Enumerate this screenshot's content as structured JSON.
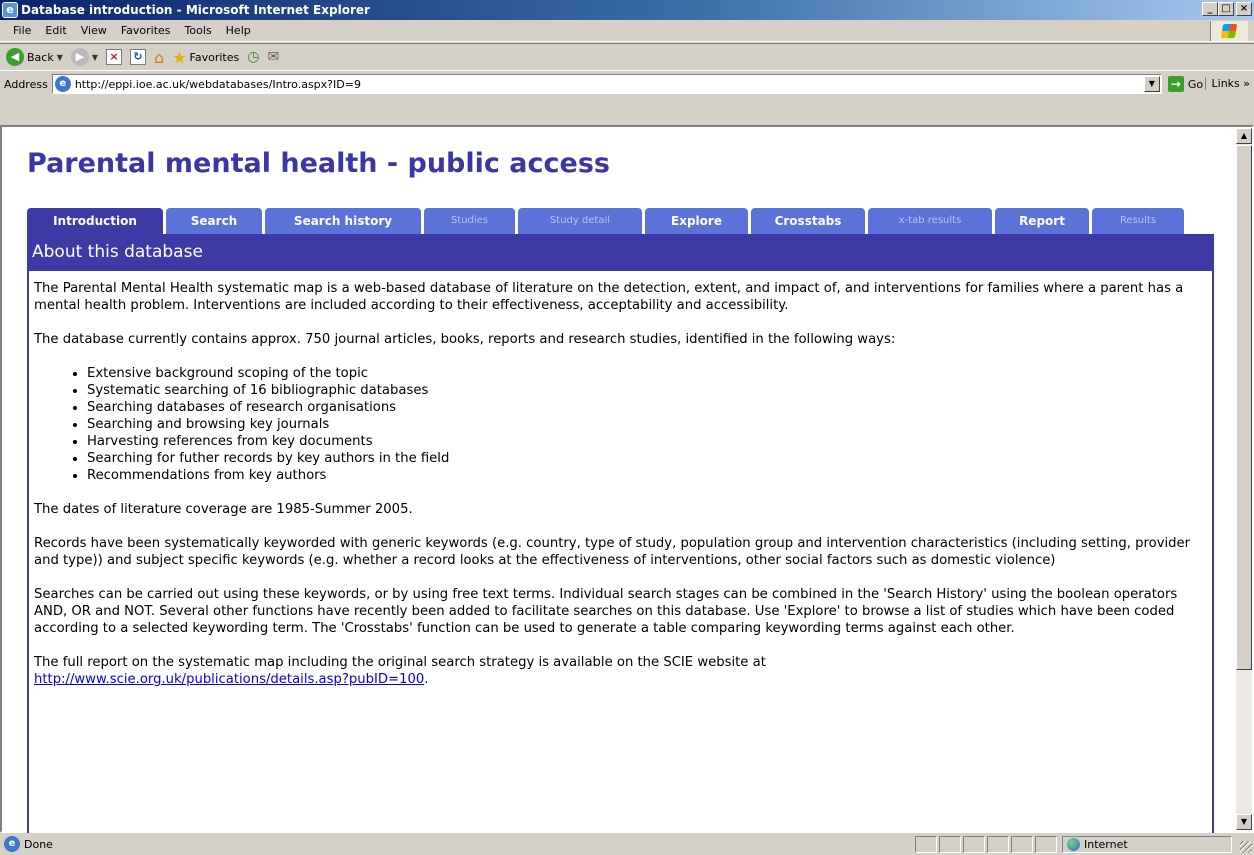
{
  "window": {
    "title": "Database introduction - Microsoft Internet Explorer",
    "minimize": "_",
    "maximize": "□",
    "close": "×"
  },
  "menubar": {
    "items": [
      "File",
      "Edit",
      "View",
      "Favorites",
      "Tools",
      "Help"
    ]
  },
  "toolbar": {
    "back_label": "Back",
    "favorites_label": "Favorites"
  },
  "address": {
    "label": "Address",
    "url": "http://eppi.ioe.ac.uk/webdatabases/Intro.aspx?ID=9",
    "go_label": "Go",
    "links_label": "Links »"
  },
  "page": {
    "title": "Parental mental health - public access",
    "tabs": [
      {
        "label": "Introduction",
        "state": "active"
      },
      {
        "label": "Search",
        "state": "enabled"
      },
      {
        "label": "Search history",
        "state": "enabled"
      },
      {
        "label": "Studies",
        "state": "disabled"
      },
      {
        "label": "Study detail",
        "state": "disabled"
      },
      {
        "label": "Explore",
        "state": "enabled"
      },
      {
        "label": "Crosstabs",
        "state": "enabled"
      },
      {
        "label": "x-tab results",
        "state": "disabled"
      },
      {
        "label": "Report",
        "state": "enabled"
      },
      {
        "label": "Results",
        "state": "disabled"
      }
    ],
    "section_header": "About this database",
    "paragraphs": {
      "intro": "The Parental Mental Health systematic map is a web-based database of literature on the detection, extent, and impact of, and interventions for families where a parent has a mental health problem. Interventions are included according to their effectiveness, acceptability and accessibility.",
      "contents": "The database currently contains approx. 750 journal articles, books, reports and research studies, identified in the following ways:",
      "dates": "The dates of literature coverage are 1985-Summer 2005.",
      "keywords": "Records have been systematically keyworded with generic keywords (e.g. country, type of study, population group and intervention characteristics (including setting, provider and type)) and subject specific keywords (e.g. whether a record looks at the effectiveness of interventions, other social factors such as domestic violence)",
      "searches": "Searches can be carried out using these keywords, or by using free text terms. Individual search stages can be combined in the 'Search History' using the boolean operators AND, OR and NOT. Several other functions have recently been added to facilitate searches on this database. Use 'Explore' to browse a list of studies which have been coded according to a selected keywording term. The 'Crosstabs' function can be used to generate a table comparing keywording terms against each other.",
      "report": "The full report on the systematic map including the original search strategy is available on the SCIE website at",
      "report_link": "http://www.scie.org.uk/publications/details.asp?pubID=100",
      "report_end": "."
    },
    "methods": [
      "Extensive background scoping of the topic",
      "Systematic searching of 16 bibliographic databases",
      "Searching databases of research organisations",
      "Searching and browsing key journals",
      "Harvesting references from key documents",
      "Searching for futher records by key authors in the field",
      "Recommendations from key authors"
    ]
  },
  "statusbar": {
    "text": "Done",
    "zone": "Internet"
  },
  "colors": {
    "title_text": "#3a37a5",
    "tab_active": "#3e3aa5",
    "tab_enabled": "#5b73d9",
    "panel_header": "#3e3aa5"
  }
}
